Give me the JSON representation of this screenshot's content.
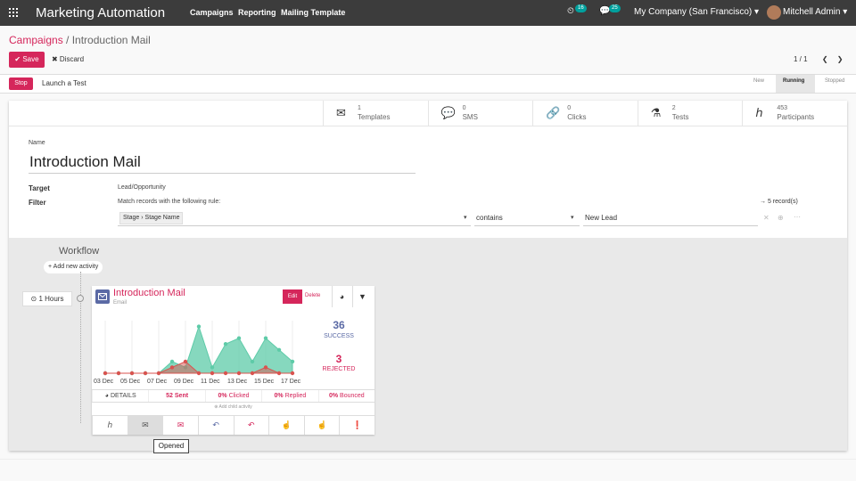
{
  "nav": {
    "brand": "Marketing Automation",
    "menus": [
      "Campaigns",
      "Reporting",
      "Mailing Template"
    ],
    "activity_count": "16",
    "message_count": "25",
    "company": "My Company (San Francisco) ▾",
    "user": "Mitchell Admin ▾"
  },
  "breadcrumb": {
    "parent": "Campaigns",
    "sep": " / ",
    "current": "Introduction Mail"
  },
  "toolbar": {
    "save": "✔ Save",
    "discard": "✖ Discard",
    "pager": "1 / 1"
  },
  "statusbar": {
    "stop": "Stop",
    "test": "Launch a Test",
    "stages": [
      "New",
      "Running",
      "Stopped"
    ],
    "active_stage": "Running"
  },
  "stats": [
    {
      "icon": "envelope-icon",
      "glyph": "✉",
      "count": "1",
      "label": "Templates"
    },
    {
      "icon": "sms-icon",
      "glyph": "💬",
      "count": "0",
      "label": "SMS"
    },
    {
      "icon": "link-icon",
      "glyph": "🔗",
      "count": "0",
      "label": "Clicks"
    },
    {
      "icon": "flask-icon",
      "glyph": "⚗",
      "count": "2",
      "label": "Tests"
    },
    {
      "icon": "participants-icon",
      "glyph": "ℎ",
      "count": "453",
      "label": "Participants"
    }
  ],
  "form": {
    "name_label": "Name",
    "name": "Introduction Mail",
    "target_label": "Target",
    "target": "Lead/Opportunity",
    "filter_label": "Filter",
    "filter_rule": "Match records with the following rule:",
    "field_a": "Stage",
    "field_b": "Stage Name",
    "operator": "contains",
    "value": "New Lead",
    "records": "5 record(s)"
  },
  "workflow": {
    "title": "Workflow",
    "add_activity": "+ Add new activity",
    "interval": "⊙ 1 Hours"
  },
  "activity": {
    "title": "Introduction Mail",
    "type": "Email",
    "edit": "Edit",
    "delete": "Delete",
    "success_count": "36",
    "success_label": "SUCCESS",
    "rejected_count": "3",
    "rejected_label": "REJECTED",
    "details": "DETAILS",
    "sent": "52 Sent",
    "clicked_pct": "0%",
    "clicked": " Clicked",
    "replied_pct": "0%",
    "replied": " Replied",
    "bounced_pct": "0%",
    "bounced": " Bounced",
    "add_child": "⊕ Add child activity",
    "tooltip": "Opened"
  },
  "colors": {
    "accent": "#d5265b",
    "success": "#5ecba8",
    "rejected": "#d9534f",
    "primary": "#5b6aa5"
  },
  "chart_data": {
    "type": "area",
    "x": [
      "03 Dec",
      "04 Dec",
      "05 Dec",
      "06 Dec",
      "07 Dec",
      "08 Dec",
      "09 Dec",
      "10 Dec",
      "11 Dec",
      "12 Dec",
      "13 Dec",
      "14 Dec",
      "15 Dec",
      "16 Dec",
      "17 Dec"
    ],
    "tick_labels": [
      "03 Dec",
      "05 Dec",
      "07 Dec",
      "09 Dec",
      "11 Dec",
      "13 Dec",
      "15 Dec",
      "17 Dec"
    ],
    "series": [
      {
        "color": "#5ecba8",
        "values": [
          0,
          0,
          0,
          0,
          0,
          2,
          1,
          8,
          1,
          5,
          6,
          2,
          6,
          4,
          2
        ]
      },
      {
        "color": "#d9534f",
        "values": [
          0,
          0,
          0,
          0,
          0,
          1,
          2,
          0,
          0,
          0,
          0,
          0,
          1,
          0,
          0
        ]
      }
    ],
    "ylim": [
      0,
      9
    ]
  }
}
